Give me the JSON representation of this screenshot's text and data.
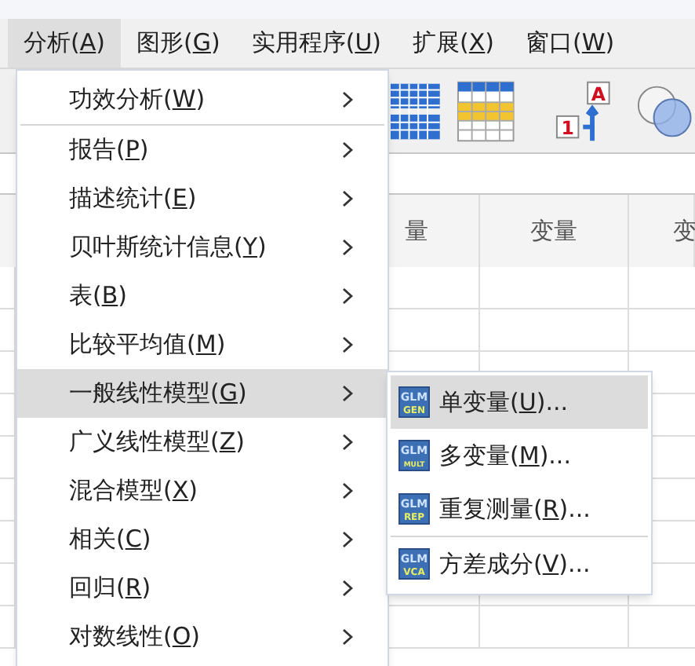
{
  "menubar": [
    {
      "label": [
        "分析(",
        "A",
        ")"
      ],
      "selected": true
    },
    {
      "label": [
        "图形(",
        "G",
        ")"
      ],
      "selected": false
    },
    {
      "label": [
        "实用程序(",
        "U",
        ")"
      ],
      "selected": false
    },
    {
      "label": [
        "扩展(",
        "X",
        ")"
      ],
      "selected": false
    },
    {
      "label": [
        "窗口(",
        "W",
        ")"
      ],
      "selected": false
    }
  ],
  "toolbar": {
    "label_icon_texts": [
      "A",
      "1"
    ]
  },
  "grid": {
    "columns": [
      "量",
      "变量",
      "变"
    ]
  },
  "menu": {
    "items": [
      {
        "label": [
          "功效分析(",
          "W",
          ")"
        ],
        "selected": false,
        "submenu": true,
        "separator_after": true
      },
      {
        "label": [
          "报告(",
          "P",
          ")"
        ],
        "selected": false,
        "submenu": true
      },
      {
        "label": [
          "描述统计(",
          "E",
          ")"
        ],
        "selected": false,
        "submenu": true
      },
      {
        "label": [
          "贝叶斯统计信息(",
          "Y",
          ")"
        ],
        "selected": false,
        "submenu": true
      },
      {
        "label": [
          "表(",
          "B",
          ")"
        ],
        "selected": false,
        "submenu": true
      },
      {
        "label": [
          "比较平均值(",
          "M",
          ")"
        ],
        "selected": false,
        "submenu": true
      },
      {
        "label": [
          "一般线性模型(",
          "G",
          ")"
        ],
        "selected": true,
        "submenu": true
      },
      {
        "label": [
          "广义线性模型(",
          "Z",
          ")"
        ],
        "selected": false,
        "submenu": true
      },
      {
        "label": [
          "混合模型(",
          "X",
          ")"
        ],
        "selected": false,
        "submenu": true
      },
      {
        "label": [
          "相关(",
          "C",
          ")"
        ],
        "selected": false,
        "submenu": true
      },
      {
        "label": [
          "回归(",
          "R",
          ")"
        ],
        "selected": false,
        "submenu": true
      },
      {
        "label": [
          "对数线性(",
          "O",
          ")"
        ],
        "selected": false,
        "submenu": true
      }
    ]
  },
  "submenu": {
    "items": [
      {
        "label": [
          "单变量(",
          "U",
          ")..."
        ],
        "icon_text": [
          "GLM",
          "GEN"
        ],
        "selected": true,
        "separator_after": false
      },
      {
        "label": [
          "多变量(",
          "M",
          ")..."
        ],
        "icon_text": [
          "GLM",
          "MULT"
        ],
        "selected": false,
        "separator_after": false
      },
      {
        "label": [
          "重复测量(",
          "R",
          ")..."
        ],
        "icon_text": [
          "GLM",
          "REP"
        ],
        "selected": false,
        "separator_after": true
      },
      {
        "label": [
          "方差成分(",
          "V",
          ")..."
        ],
        "icon_text": [
          "GLM",
          "VCA"
        ],
        "selected": false,
        "separator_after": false
      }
    ]
  }
}
